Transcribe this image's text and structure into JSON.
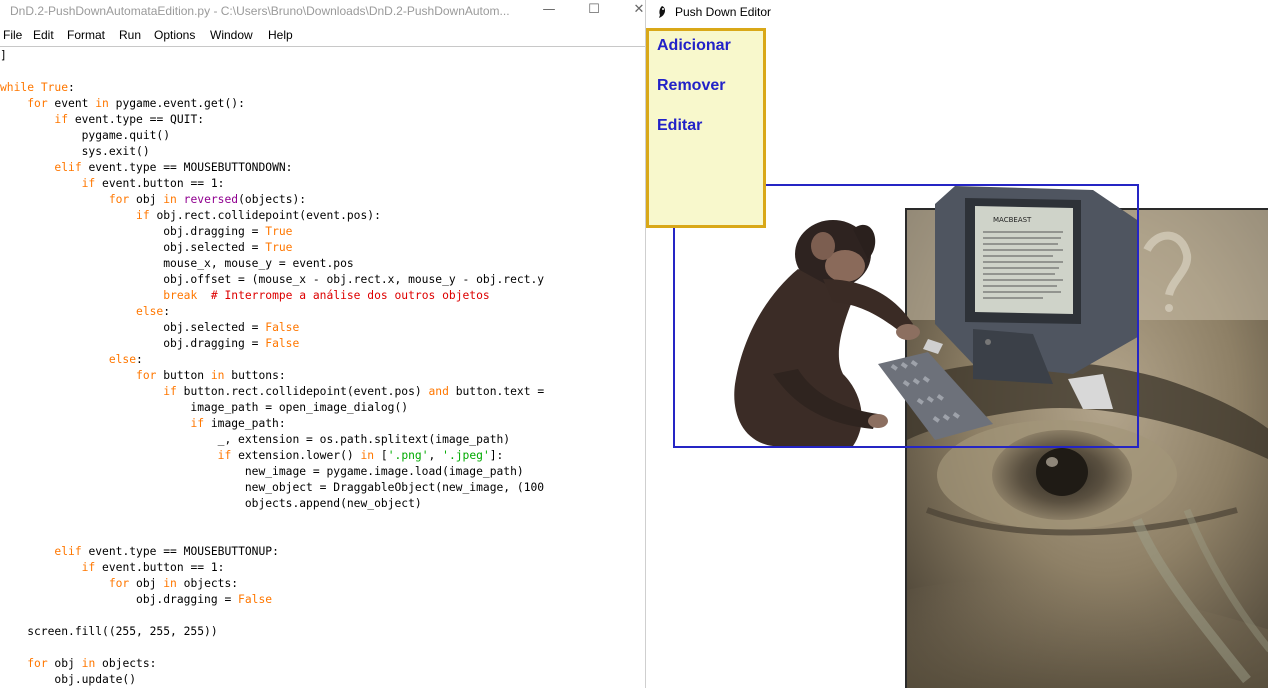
{
  "idle": {
    "title": "DnD.2-PushDownAutomataEdition.py - C:\\Users\\Bruno\\Downloads\\DnD.2-PushDownAutom...",
    "window_controls": {
      "minimize": "—",
      "maximize": "☐",
      "close": "✕"
    },
    "menu": [
      "File",
      "Edit",
      "Format",
      "Run",
      "Options",
      "Window",
      "Help"
    ],
    "code_lines": [
      [
        [
          "n",
          "]"
        ]
      ],
      [],
      [
        [
          "k",
          "while"
        ],
        [
          "n",
          " "
        ],
        [
          "k",
          "True"
        ],
        [
          "n",
          ":"
        ]
      ],
      [
        [
          "n",
          "    "
        ],
        [
          "k",
          "for"
        ],
        [
          "n",
          " event "
        ],
        [
          "k",
          "in"
        ],
        [
          "n",
          " pygame.event.get():"
        ]
      ],
      [
        [
          "n",
          "        "
        ],
        [
          "k",
          "if"
        ],
        [
          "n",
          " event.type == QUIT:"
        ]
      ],
      [
        [
          "n",
          "            pygame.quit()"
        ]
      ],
      [
        [
          "n",
          "            sys.exit()"
        ]
      ],
      [
        [
          "n",
          "        "
        ],
        [
          "k",
          "elif"
        ],
        [
          "n",
          " event.type == MOUSEBUTTONDOWN:"
        ]
      ],
      [
        [
          "n",
          "            "
        ],
        [
          "k",
          "if"
        ],
        [
          "n",
          " event.button == 1:"
        ]
      ],
      [
        [
          "n",
          "                "
        ],
        [
          "k",
          "for"
        ],
        [
          "n",
          " obj "
        ],
        [
          "k",
          "in"
        ],
        [
          "n",
          " "
        ],
        [
          "b",
          "reversed"
        ],
        [
          "n",
          "(objects):"
        ]
      ],
      [
        [
          "n",
          "                    "
        ],
        [
          "k",
          "if"
        ],
        [
          "n",
          " obj.rect.collidepoint(event.pos):"
        ]
      ],
      [
        [
          "n",
          "                        obj.dragging = "
        ],
        [
          "k",
          "True"
        ]
      ],
      [
        [
          "n",
          "                        obj.selected = "
        ],
        [
          "k",
          "True"
        ]
      ],
      [
        [
          "n",
          "                        mouse_x, mouse_y = event.pos"
        ]
      ],
      [
        [
          "n",
          "                        obj.offset = (mouse_x - obj.rect.x, mouse_y - obj.rect.y"
        ]
      ],
      [
        [
          "n",
          "                        "
        ],
        [
          "k",
          "break"
        ],
        [
          "n",
          "  "
        ],
        [
          "c",
          "# Interrompe a análise dos outros objetos"
        ]
      ],
      [
        [
          "n",
          "                    "
        ],
        [
          "k",
          "else"
        ],
        [
          "n",
          ":"
        ]
      ],
      [
        [
          "n",
          "                        obj.selected = "
        ],
        [
          "k",
          "False"
        ]
      ],
      [
        [
          "n",
          "                        obj.dragging = "
        ],
        [
          "k",
          "False"
        ]
      ],
      [
        [
          "n",
          "                "
        ],
        [
          "k",
          "else"
        ],
        [
          "n",
          ":"
        ]
      ],
      [
        [
          "n",
          "                    "
        ],
        [
          "k",
          "for"
        ],
        [
          "n",
          " button "
        ],
        [
          "k",
          "in"
        ],
        [
          "n",
          " buttons:"
        ]
      ],
      [
        [
          "n",
          "                        "
        ],
        [
          "k",
          "if"
        ],
        [
          "n",
          " button.rect.collidepoint(event.pos) "
        ],
        [
          "k",
          "and"
        ],
        [
          "n",
          " button.text ="
        ]
      ],
      [
        [
          "n",
          "                            image_path = open_image_dialog()"
        ]
      ],
      [
        [
          "n",
          "                            "
        ],
        [
          "k",
          "if"
        ],
        [
          "n",
          " image_path:"
        ]
      ],
      [
        [
          "n",
          "                                _, extension = os.path.splitext(image_path)"
        ]
      ],
      [
        [
          "n",
          "                                "
        ],
        [
          "k",
          "if"
        ],
        [
          "n",
          " extension.lower() "
        ],
        [
          "k",
          "in"
        ],
        [
          "n",
          " ["
        ],
        [
          "s",
          "'.png'"
        ],
        [
          "n",
          ", "
        ],
        [
          "s",
          "'.jpeg'"
        ],
        [
          "n",
          "]:"
        ]
      ],
      [
        [
          "n",
          "                                    new_image = pygame.image.load(image_path)"
        ]
      ],
      [
        [
          "n",
          "                                    new_object = DraggableObject(new_image, (100"
        ]
      ],
      [
        [
          "n",
          "                                    objects.append(new_object)"
        ]
      ],
      [],
      [],
      [
        [
          "n",
          "        "
        ],
        [
          "k",
          "elif"
        ],
        [
          "n",
          " event.type == MOUSEBUTTONUP:"
        ]
      ],
      [
        [
          "n",
          "            "
        ],
        [
          "k",
          "if"
        ],
        [
          "n",
          " event.button == 1:"
        ]
      ],
      [
        [
          "n",
          "                "
        ],
        [
          "k",
          "for"
        ],
        [
          "n",
          " obj "
        ],
        [
          "k",
          "in"
        ],
        [
          "n",
          " objects:"
        ]
      ],
      [
        [
          "n",
          "                    obj.dragging = "
        ],
        [
          "k",
          "False"
        ]
      ],
      [],
      [
        [
          "n",
          "    screen.fill((255, 255, 255))"
        ]
      ],
      [],
      [
        [
          "n",
          "    "
        ],
        [
          "k",
          "for"
        ],
        [
          "n",
          " obj "
        ],
        [
          "k",
          "in"
        ],
        [
          "n",
          " objects:"
        ]
      ],
      [
        [
          "n",
          "        obj.update()"
        ]
      ]
    ]
  },
  "editor": {
    "title": "Push Down Editor",
    "menu_buttons": [
      "Adicionar",
      "Remover",
      "Editar"
    ],
    "monitor_label": "MACBEAST"
  },
  "colors": {
    "keyword": "#ff7700",
    "builtin": "#900090",
    "string": "#00aa00",
    "comment": "#dd0000",
    "panel_bg": "#f8f8cc",
    "panel_border": "#d9a818",
    "button_text": "#2222c8",
    "selection": "#2525c4"
  }
}
